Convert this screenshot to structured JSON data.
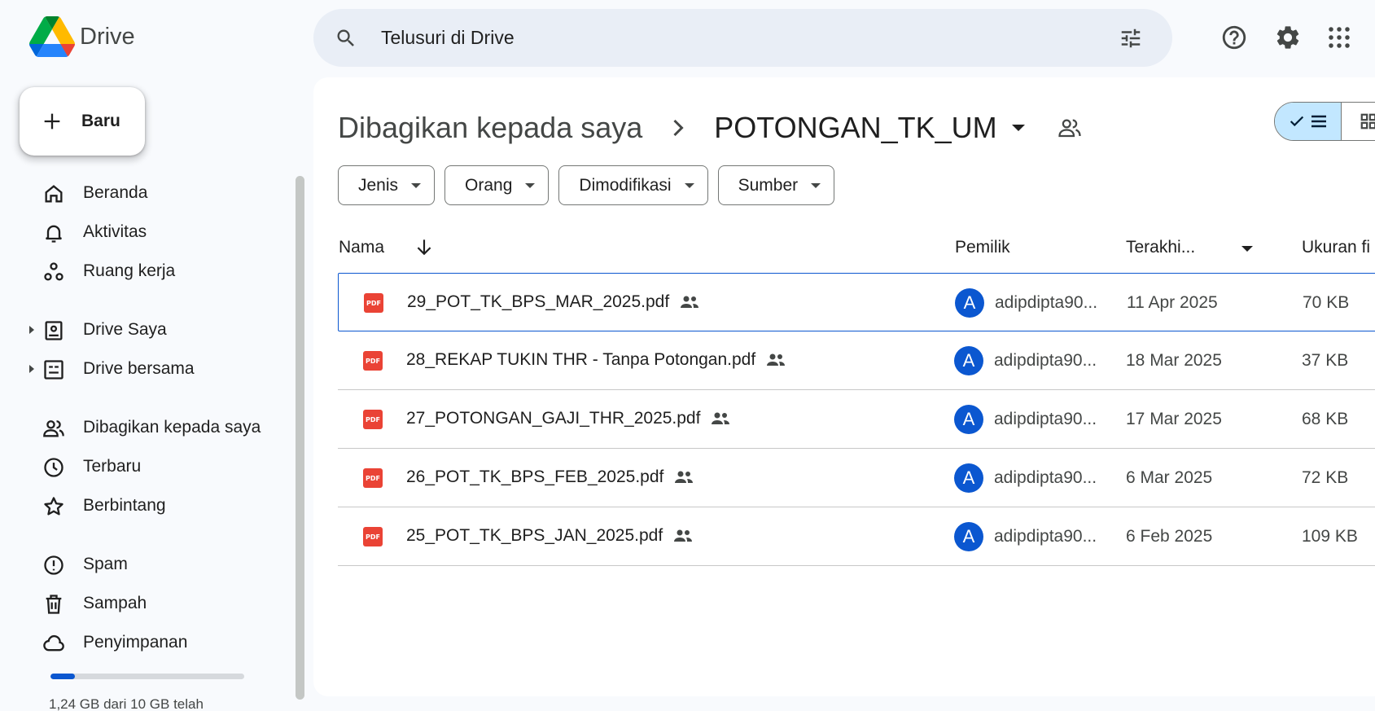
{
  "app": {
    "name": "Drive"
  },
  "search": {
    "placeholder": "Telusuri di Drive"
  },
  "header_icons": [
    "help-icon",
    "settings-icon",
    "apps-grid-icon"
  ],
  "sidebar": {
    "new_label": "Baru",
    "items": [
      {
        "label": "Beranda",
        "icon": "home-icon"
      },
      {
        "label": "Aktivitas",
        "icon": "bell-icon"
      },
      {
        "label": "Ruang kerja",
        "icon": "workspaces-icon"
      },
      {
        "label": "Drive Saya",
        "icon": "my-drive-icon",
        "expandable": true
      },
      {
        "label": "Drive bersama",
        "icon": "shared-drives-icon",
        "expandable": true
      },
      {
        "label": "Dibagikan kepada saya",
        "icon": "shared-with-me-icon"
      },
      {
        "label": "Terbaru",
        "icon": "clock-icon"
      },
      {
        "label": "Berbintang",
        "icon": "star-icon"
      },
      {
        "label": "Spam",
        "icon": "spam-icon"
      },
      {
        "label": "Sampah",
        "icon": "trash-icon"
      },
      {
        "label": "Penyimpanan",
        "icon": "cloud-icon"
      }
    ],
    "storage": {
      "used_fraction": 0.124,
      "text": "1,24 GB dari 10 GB telah"
    }
  },
  "breadcrumb": {
    "parent": "Dibagikan kepada saya",
    "current": "POTONGAN_TK_UM"
  },
  "filters": [
    "Jenis",
    "Orang",
    "Dimodifikasi",
    "Sumber"
  ],
  "table": {
    "columns": {
      "name": "Nama",
      "owner": "Pemilik",
      "modified": "Terakhi...",
      "size": "Ukuran fi"
    },
    "rows": [
      {
        "name": "29_POT_TK_BPS_MAR_2025.pdf",
        "owner_initial": "A",
        "owner": "adipdipta90...",
        "modified": "11 Apr 2025",
        "size": "70 KB",
        "selected": true
      },
      {
        "name": "28_REKAP TUKIN THR - Tanpa Potongan.pdf",
        "owner_initial": "A",
        "owner": "adipdipta90...",
        "modified": "18 Mar 2025",
        "size": "37 KB"
      },
      {
        "name": "27_POTONGAN_GAJI_THR_2025.pdf",
        "owner_initial": "A",
        "owner": "adipdipta90...",
        "modified": "17 Mar 2025",
        "size": "68 KB"
      },
      {
        "name": "26_POT_TK_BPS_FEB_2025.pdf",
        "owner_initial": "A",
        "owner": "adipdipta90...",
        "modified": "6 Mar 2025",
        "size": "72 KB"
      },
      {
        "name": "25_POT_TK_BPS_JAN_2025.pdf",
        "owner_initial": "A",
        "owner": "adipdipta90...",
        "modified": "6 Feb 2025",
        "size": "109 KB"
      }
    ],
    "file_icon_label": "PDF"
  },
  "colors": {
    "accent": "#0b57d0",
    "pdf": "#ea4335",
    "toggle_active": "#c2e7ff",
    "search_bg": "#e9eef6"
  }
}
